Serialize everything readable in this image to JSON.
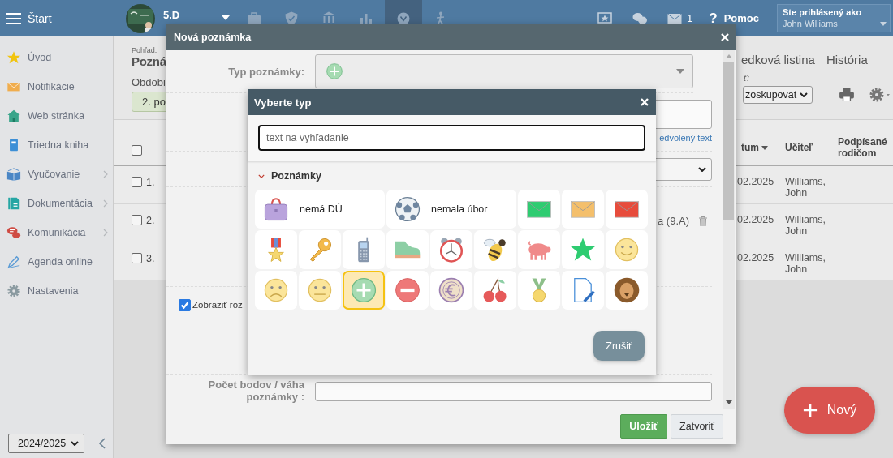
{
  "top_bar": {
    "menu_label": "Štart",
    "class_name": "5.D",
    "toolbar": [
      {
        "kind": "briefcase",
        "selected": false
      },
      {
        "kind": "shield",
        "selected": false
      },
      {
        "kind": "bank",
        "selected": false
      },
      {
        "kind": "barchart",
        "selected": false
      },
      {
        "kind": "target",
        "selected": true
      },
      {
        "kind": "person",
        "selected": false
      }
    ],
    "mail_count": "1",
    "help_mark": "?",
    "help_label": "Pomoc",
    "login_caption": "Ste prihlásený ako",
    "user_name": "John Williams"
  },
  "sidebar": {
    "items": [
      {
        "label": "Úvod",
        "kind": "star",
        "submenu": false
      },
      {
        "label": "Notifikácie",
        "kind": "mail",
        "submenu": false
      },
      {
        "label": "Web stránka",
        "kind": "house",
        "submenu": false
      },
      {
        "label": "Triedna kniha",
        "kind": "notebook",
        "submenu": false
      },
      {
        "label": "Vyučovanie",
        "kind": "openbook",
        "submenu": true
      },
      {
        "label": "Dokumentácia",
        "kind": "document",
        "submenu": true
      },
      {
        "label": "Komunikácia",
        "kind": "chat",
        "submenu": true
      },
      {
        "label": "Agenda online",
        "kind": "pen",
        "submenu": false
      },
      {
        "label": "Nastavenia",
        "kind": "gear",
        "submenu": false
      }
    ],
    "year": "2024/2025"
  },
  "page": {
    "view_caption": "Pohľad:",
    "title": "Pozná",
    "period_label": "Obdobi",
    "period_button": "2. po",
    "tabs": [
      "edková listina",
      "História"
    ],
    "group_label": "ť:",
    "group_select": "zoskupovat",
    "table": {
      "all_checked": false,
      "columns": [
        {
          "label": "tum",
          "sorted": true
        },
        {
          "label": "Učiteľ",
          "sorted": false
        },
        {
          "label": "Podpísané rodičom",
          "sorted": false
        }
      ],
      "rows": [
        {
          "number": "1.",
          "checked": false,
          "date": "02.2025",
          "teacher": "Williams, John"
        },
        {
          "number": "2.",
          "checked": false,
          "date": "02.2025",
          "teacher": "Williams, John"
        },
        {
          "number": "3.",
          "checked": false,
          "date": "02.2025",
          "teacher": "Williams, John"
        }
      ]
    }
  },
  "modal": {
    "title": "Nová poznámka",
    "type_label": "Typ poznámky:",
    "link": "edvolený text",
    "student": "a (9.A)",
    "show_more": {
      "label": "Zobraziť roz",
      "checked": true
    },
    "points_label": "Počet bodov / váha poznámky :",
    "buttons": [
      {
        "label": "Uložiť",
        "kind": "primary"
      },
      {
        "label": "Zatvoriť",
        "kind": "default"
      }
    ]
  },
  "type_dialog": {
    "title": "Vyberte typ",
    "search": {
      "placeholder": "text na vyhľadanie"
    },
    "section": {
      "title": "Poznámky",
      "expanded": true
    },
    "tiles": [
      {
        "kind": "bag",
        "label": "nemá DÚ",
        "selected": false
      },
      {
        "kind": "ball",
        "label": "nemala úbor",
        "selected": false
      },
      {
        "kind": "envelope",
        "color": "#2ecc71",
        "selected": false
      },
      {
        "kind": "envelope",
        "color": "#f4bf6b",
        "selected": false
      },
      {
        "kind": "envelope",
        "color": "#e74c3c",
        "selected": false
      },
      {
        "kind": "medal_star",
        "selected": false
      },
      {
        "kind": "key",
        "selected": false
      },
      {
        "kind": "phone",
        "selected": false
      },
      {
        "kind": "shoe",
        "selected": false
      },
      {
        "kind": "clock",
        "selected": false
      },
      {
        "kind": "bee",
        "selected": false
      },
      {
        "kind": "pig",
        "selected": false
      },
      {
        "kind": "star",
        "selected": false
      },
      {
        "kind": "smile",
        "selected": false
      },
      {
        "kind": "sad",
        "selected": false
      },
      {
        "kind": "neutral",
        "selected": false
      },
      {
        "kind": "plus",
        "selected": true
      },
      {
        "kind": "minus",
        "selected": false
      },
      {
        "kind": "euro",
        "selected": false
      },
      {
        "kind": "cherry",
        "selected": false
      },
      {
        "kind": "medal",
        "selected": false
      },
      {
        "kind": "document_pen",
        "selected": false
      },
      {
        "kind": "lion",
        "selected": false
      }
    ],
    "cancel": "Zrušiť"
  },
  "fab": {
    "label": "Nový"
  }
}
